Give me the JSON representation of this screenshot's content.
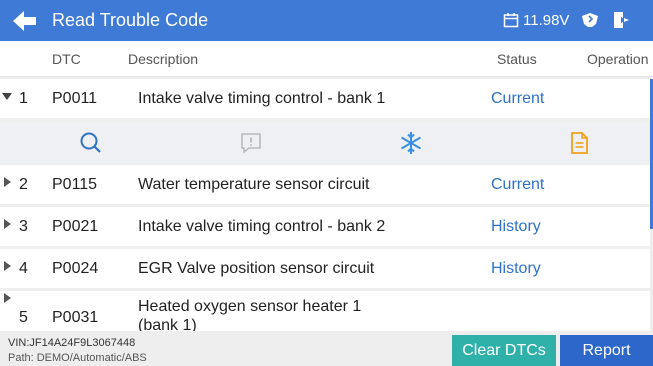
{
  "topbar": {
    "title": "Read Trouble Code",
    "battery_voltage": "11.98V",
    "accent_color": "#3f7ad6"
  },
  "icons": {
    "back": "back-arrow-icon",
    "calendar": "calendar-icon",
    "vci": "vci-connector-icon",
    "exit": "exit-icon",
    "search": "search-icon",
    "info": "info-message-icon",
    "freeze_frame": "snowflake-icon",
    "report": "document-icon"
  },
  "table": {
    "headers": {
      "dtc": "DTC",
      "description": "Description",
      "status": "Status",
      "operation": "Operation"
    },
    "rows": [
      {
        "num": "1",
        "code": "P0011",
        "description": "Intake valve timing control - bank 1",
        "status": "Current",
        "expanded": true
      },
      {
        "num": "2",
        "code": "P0115",
        "description": "Water temperature sensor circuit",
        "status": "Current"
      },
      {
        "num": "3",
        "code": "P0021",
        "description": "Intake valve timing control - bank 2",
        "status": "History"
      },
      {
        "num": "4",
        "code": "P0024",
        "description": "EGR Valve position sensor circuit",
        "status": "History"
      },
      {
        "num": "5",
        "code": "P0031",
        "description_line1": "Heated oxygen sensor heater 1",
        "description_line2": "(bank 1)",
        "status": ""
      }
    ]
  },
  "footer": {
    "vin": "VIN:JF14A24F9L3067448",
    "path": "Path:  DEMO/Automatic/ABS",
    "clear_label": "Clear DTCs",
    "report_label": "Report"
  },
  "colors": {
    "status_text": "#2f72c8",
    "clear_button": "#2fb0a8",
    "report_button": "#2c67c9",
    "search_icon": "#2f72c8",
    "snowflake_icon": "#3b8ee6",
    "document_icon": "#f0a020"
  }
}
